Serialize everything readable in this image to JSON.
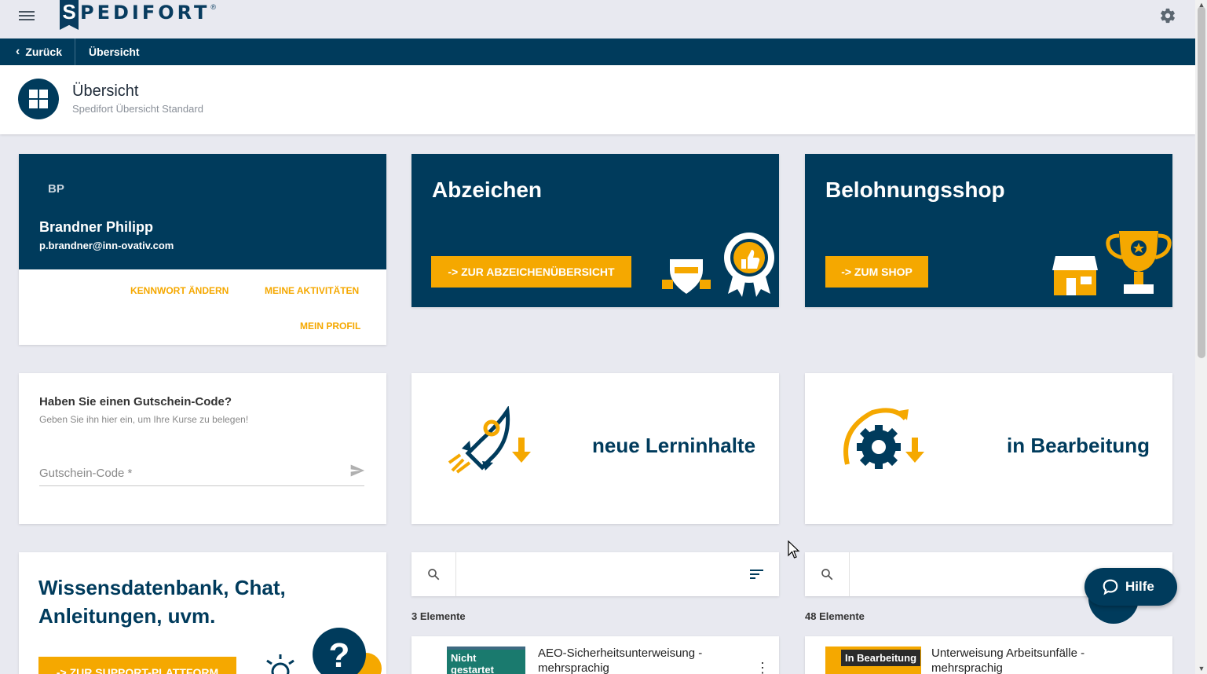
{
  "app": {
    "logo_text": "PEDIFORT",
    "logo_mark": "S",
    "logo_reg": "®"
  },
  "nav": {
    "back_label": "Zurück",
    "crumb": "Übersicht"
  },
  "header": {
    "title": "Übersicht",
    "subtitle": "Spedifort Übersicht Standard"
  },
  "profile": {
    "initials": "BP",
    "name": "Brandner Philipp",
    "email": "p.brandner@inn-ovativ.com",
    "link_password": "Kennwort ändern",
    "link_activities": "Meine Aktivitäten",
    "link_profile": "Mein Profil"
  },
  "badges_card": {
    "title": "Abzeichen",
    "button": "-> Zur Abzeichenübersicht"
  },
  "shop_card": {
    "title": "Belohnungsshop",
    "button": "-> Zum Shop"
  },
  "voucher": {
    "title": "Haben Sie einen Gutschein-Code?",
    "subtitle": "Geben Sie ihn hier ein, um Ihre Kurse zu belegen!",
    "placeholder": "Gutschein-Code *"
  },
  "tile_new": {
    "label": "neue Lerninhalte"
  },
  "tile_progress": {
    "label": "in Bearbeitung"
  },
  "knowledge": {
    "title_line1": "Wissensdatenbank, Chat,",
    "title_line2": "Anleitungen, uvm.",
    "button": "-> Zur Support-Plattform"
  },
  "list_new": {
    "count": "3 Elemente",
    "items": [
      {
        "badge": "Nicht gestartet",
        "title_line1": "AEO-Sicherheitsunterweisung -",
        "title_line2": "mehrsprachig"
      }
    ]
  },
  "list_progress": {
    "count": "48 Elemente",
    "items": [
      {
        "badge": "In Bearbeitung",
        "title_line1": "Unterweisung Arbeitsunfälle -",
        "title_line2": "mehrsprachig"
      }
    ]
  },
  "help": {
    "label": "Hilfe"
  },
  "colors": {
    "primary": "#003b5c",
    "accent": "#f5a800",
    "background": "#e8e9f0",
    "badge_not_started": "#1a7a6e"
  }
}
